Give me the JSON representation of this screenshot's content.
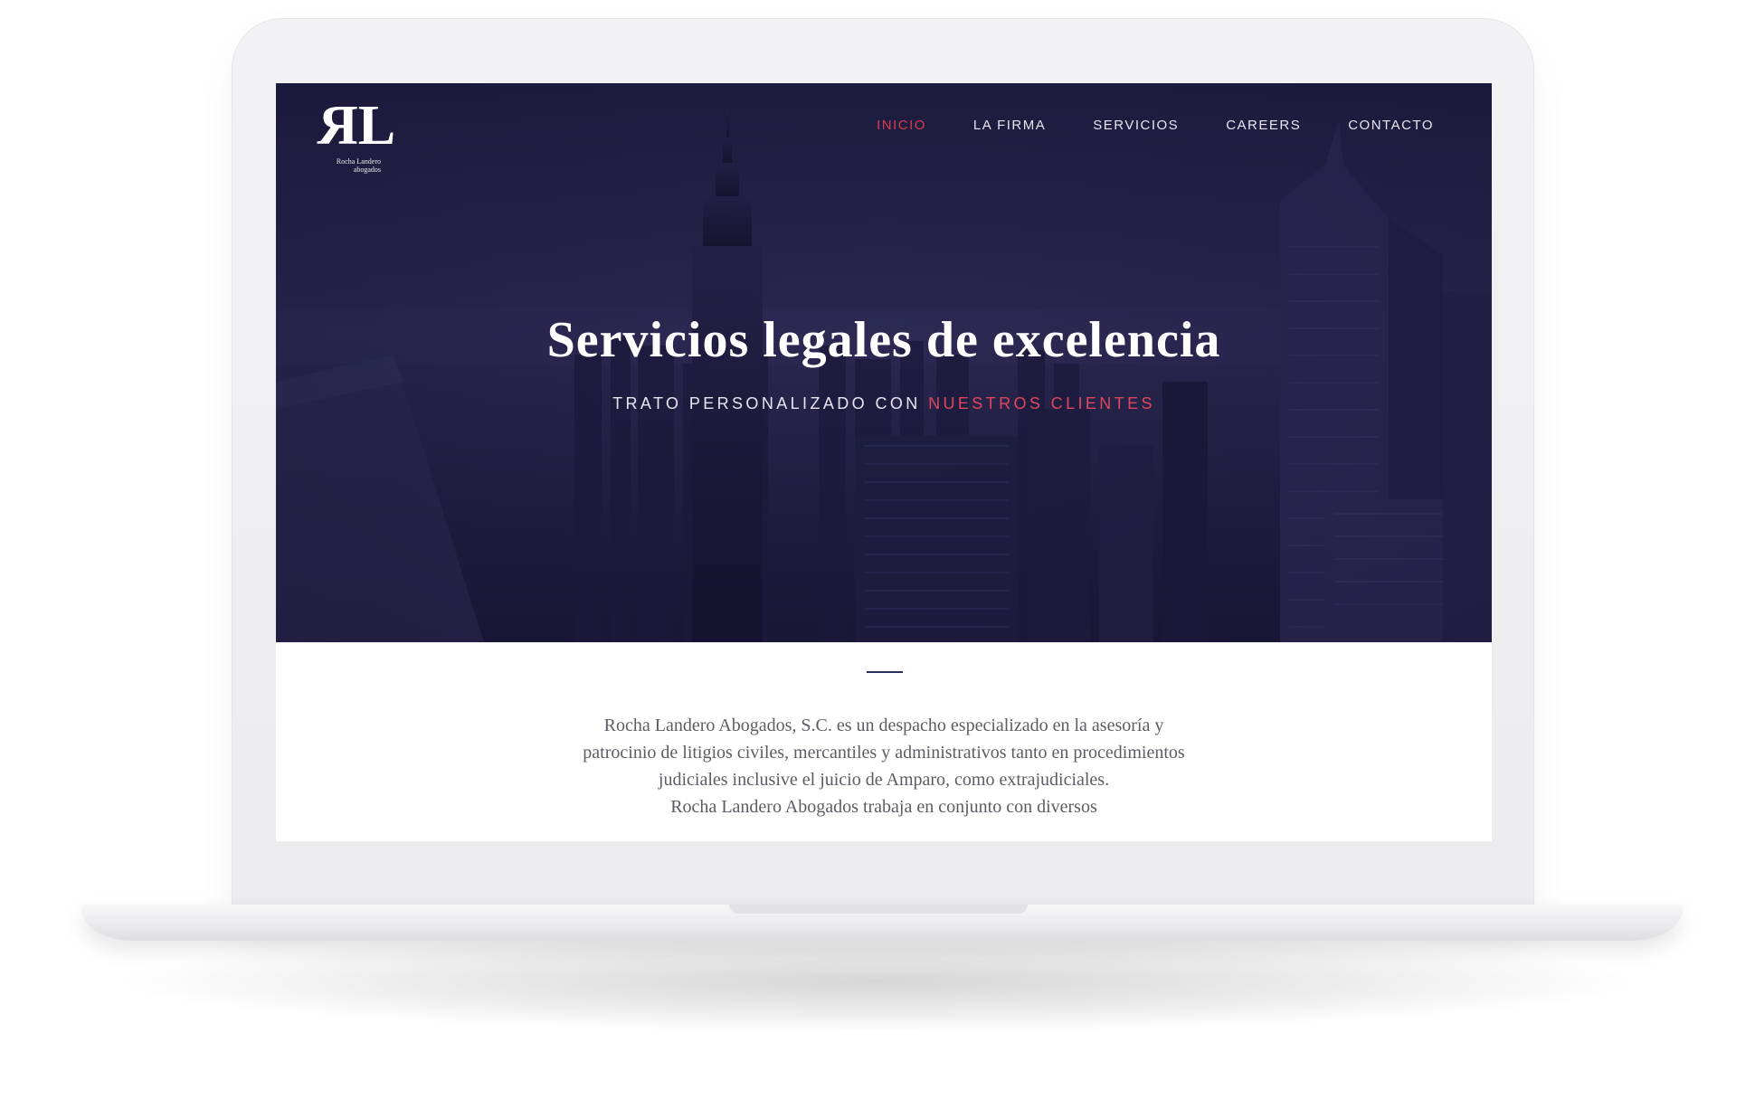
{
  "colors": {
    "hero_bg": "#1b1939",
    "accent": "#d63b52",
    "text_light": "#e7e6f2",
    "body_text": "#5c5c66",
    "divider": "#2a2f5a"
  },
  "logo": {
    "mark": "RL",
    "name": "Rocha Landero",
    "tagline": "abogados"
  },
  "nav": {
    "items": [
      {
        "label": "INICIO",
        "active": true
      },
      {
        "label": "LA FIRMA",
        "active": false
      },
      {
        "label": "SERVICIOS",
        "active": false
      },
      {
        "label": "CAREERS",
        "active": false
      },
      {
        "label": "CONTACTO",
        "active": false
      }
    ]
  },
  "hero": {
    "title": "Servicios legales de excelencia",
    "subtitle_prefix": "TRATO PERSONALIZADO CON",
    "subtitle_accent": "NUESTROS CLIENTES"
  },
  "intro": {
    "lines": [
      "Rocha Landero Abogados, S.C. es un despacho especializado en la asesoría y",
      "patrocinio de litigios civiles, mercantiles y administrativos tanto en procedimientos",
      "judiciales inclusive el juicio de Amparo, como extrajudiciales.",
      "Rocha Landero Abogados trabaja en conjunto con diversos"
    ]
  }
}
